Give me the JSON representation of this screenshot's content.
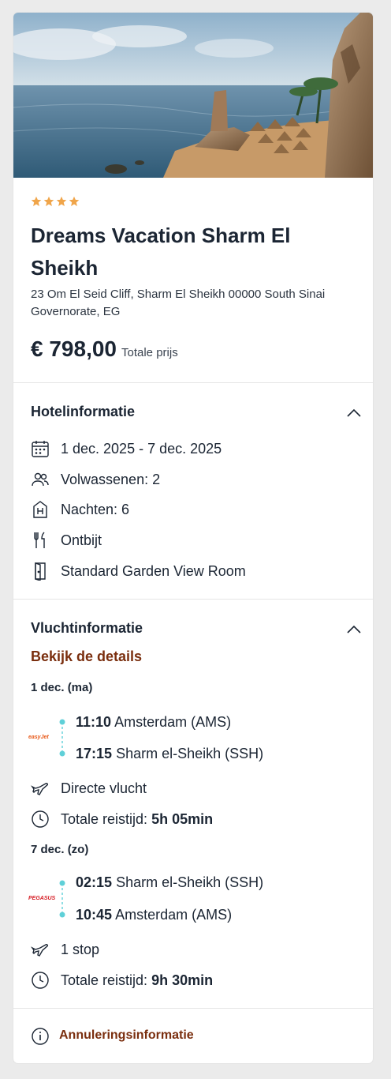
{
  "hotel": {
    "stars": 4,
    "name": "Dreams Vacation Sharm El Sheikh",
    "address": "23 Om El Seid Cliff, Sharm El Sheikh 00000 South Sinai Governorate, EG",
    "price": "€ 798,00",
    "price_label": "Totale prijs"
  },
  "hotel_info": {
    "title": "Hotelinformatie",
    "dates": "1 dec. 2025 - 7 dec. 2025",
    "adults": "Volwassenen: 2",
    "nights": "Nachten: 6",
    "board": "Ontbijt",
    "room": "Standard Garden View Room"
  },
  "flight_info": {
    "title": "Vluchtinformatie",
    "details_link": "Bekijk de details",
    "outbound": {
      "date": "1 dec. (ma)",
      "airline": "easyJet",
      "dep_time": "11:10",
      "dep_place": "Amsterdam (AMS)",
      "arr_time": "17:15",
      "arr_place": "Sharm el-Sheikh (SSH)",
      "type": "Directe vlucht",
      "duration_label": "Totale reistijd:",
      "duration": "5h 05min"
    },
    "return": {
      "date": "7 dec. (zo)",
      "airline": "PEGASUS",
      "dep_time": "02:15",
      "dep_place": "Sharm el-Sheikh (SSH)",
      "arr_time": "10:45",
      "arr_place": "Amsterdam (AMS)",
      "type": "1 stop",
      "duration_label": "Totale reistijd:",
      "duration": "9h 30min"
    }
  },
  "cancellation": {
    "label": "Annuleringsinformatie"
  },
  "colors": {
    "star": "#f0a54a",
    "link": "#7a2e0e",
    "timeline": "#5fd0d8",
    "easyjet": "#e85a1a",
    "pegasus": "#d61f26"
  }
}
